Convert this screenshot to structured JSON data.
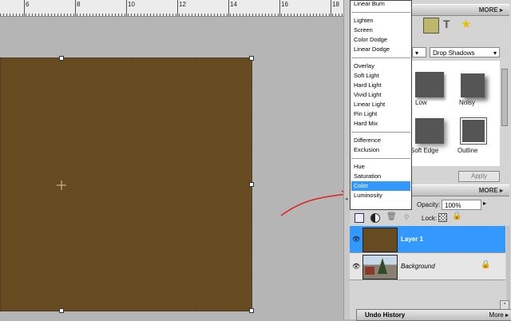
{
  "ruler": {
    "labels": [
      "6",
      "8",
      "10",
      "12",
      "14",
      "16",
      "18"
    ]
  },
  "effects_panel": {
    "more_label": "MORE ▸",
    "filter_select": "Drop Shadows",
    "thumbs": [
      {
        "label": "Low",
        "icon": "low-shadow-icon"
      },
      {
        "label": "Noisy",
        "icon": "noisy-shadow-icon"
      },
      {
        "label": "Soft Edge",
        "icon": "soft-edge-shadow-icon"
      },
      {
        "label": "Outline",
        "icon": "outline-shadow-icon"
      }
    ],
    "apply_label": "Apply"
  },
  "layers_panel": {
    "more_label": "MORE ▸",
    "opacity_label": "Opacity:",
    "opacity_value": "100%",
    "lock_label": "Lock:",
    "layers": [
      {
        "name": "Layer 1",
        "selected": true,
        "color": "#654b1f"
      },
      {
        "name": "Background",
        "selected": false
      }
    ]
  },
  "undo_panel": {
    "title": "Undo History",
    "more_label": "More ▸"
  },
  "blend_menu": {
    "groups": [
      [
        "Linear Burn"
      ],
      [
        "Lighten",
        "Screen",
        "Color Dodge",
        "Linear Dodge"
      ],
      [
        "Overlay",
        "Soft Light",
        "Hard Light",
        "Vivid Light",
        "Linear Light",
        "Pin Light",
        "Hard Mix"
      ],
      [
        "Difference",
        "Exclusion"
      ],
      [
        "Hue",
        "Saturation",
        "Color",
        "Luminosity"
      ]
    ],
    "active_item": "Color"
  },
  "colors": {
    "accent": "#3399ff",
    "layer_fill": "#654b1f",
    "annotation": "#e02020"
  }
}
